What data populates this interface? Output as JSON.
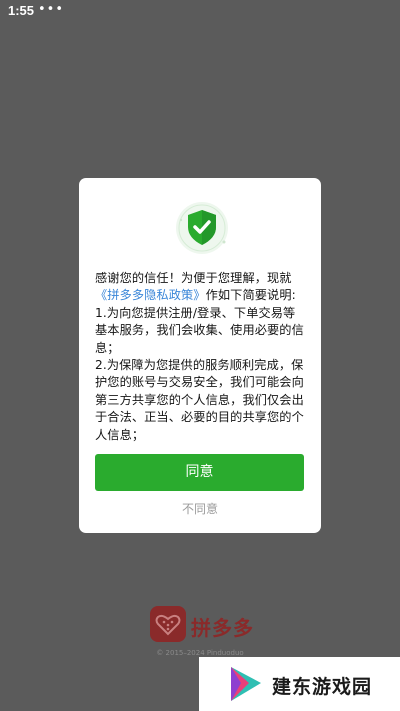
{
  "status_bar": {
    "time": "1:55",
    "dots": "•••"
  },
  "dialog": {
    "icon": "shield-check-icon",
    "paragraph_1_prefix": "感谢您的信任！为便于您理解，现就",
    "policy_link": "《拼多多隐私政策》",
    "paragraph_1_suffix": "作如下简要说明:",
    "paragraph_2": "1.为向您提供注册/登录、下单交易等基本服务，我们会收集、使用必要的信息；",
    "paragraph_3": "2.为保障为您提供的服务顺利完成，保护您的账号与交易安全，我们可能会向第三方共享您的个人信息，我们仅会出于合法、正当、必要的目的共享您的个人信息；",
    "agree_label": "同意",
    "disagree_label": "不同意"
  },
  "background": {
    "brand_name": "拼多多",
    "copyright": "© 2015–2024 Pinduoduo"
  },
  "watermark": {
    "text": "建东游戏园"
  },
  "colors": {
    "overlay": "#5b5b5b",
    "accent_green": "#2aab2e",
    "link_blue": "#3a86d8",
    "brand_red": "#8a2a2a"
  }
}
